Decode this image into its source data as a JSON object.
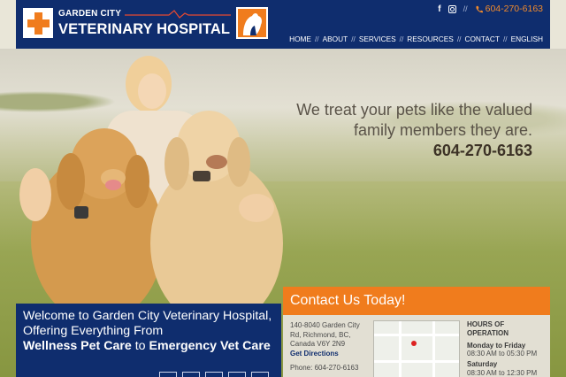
{
  "header": {
    "logo": {
      "line1": "GARDEN CITY",
      "line2": "VETERINARY HOSPITAL"
    },
    "top_links": {
      "separator": "//",
      "phone": "604-270-6163",
      "social": [
        "facebook-icon",
        "instagram-icon"
      ]
    },
    "nav": {
      "items": [
        "HOME",
        "ABOUT",
        "SERVICES",
        "RESOURCES",
        "CONTACT",
        "ENGLISH"
      ],
      "separator": "//"
    }
  },
  "hero": {
    "tagline_line1": "We treat your pets like the valued",
    "tagline_line2": "family members they are.",
    "phone": "604-270-6163"
  },
  "welcome": {
    "text_intro": "Welcome to Garden City Veterinary Hospital, Offering Everything From",
    "bold1": "Wellness Pet Care",
    "connector": "to",
    "bold2": "Emergency Vet Care"
  },
  "contact": {
    "heading": "Contact Us Today!",
    "address_line1": "140-8040 Garden City",
    "address_line2": "Rd, Richmond, BC,",
    "address_line3": "Canada V6Y 2N9",
    "directions": "Get Directions",
    "phone": "Phone: 604-270-6163",
    "hours": {
      "title_line1": "HOURS OF",
      "title_line2": "OPERATION",
      "weekday_label": "Monday to Friday",
      "weekday_time": "08:30 AM to 05:30 PM",
      "saturday_label": "Saturday",
      "saturday_time": "08:30 AM to 12:30 PM"
    }
  },
  "colors": {
    "navy": "#0f2d6e",
    "orange": "#f07c1d"
  }
}
